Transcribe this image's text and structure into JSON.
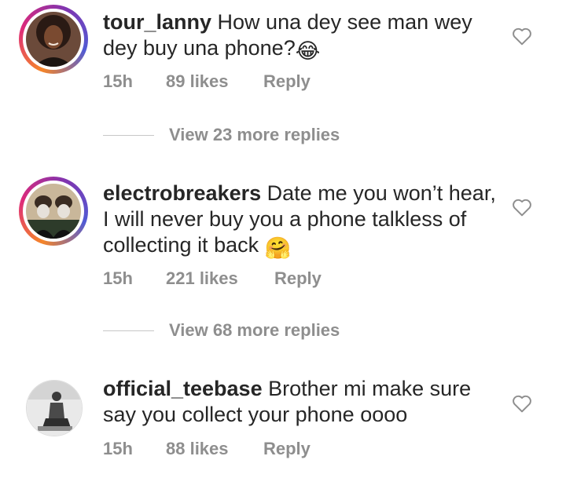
{
  "comments": [
    {
      "username": "tour_lanny",
      "text": "How una dey see man wey dey buy una phone?",
      "emoji": "😂",
      "time": "15h",
      "likes": "89 likes",
      "reply": "Reply",
      "view_more": "View 23 more replies",
      "avatar_story_ring": true
    },
    {
      "username": "electrobreakers",
      "text": "Date me you won’t hear, I will never buy you a phone talkless of collecting it back",
      "emoji": "🤗",
      "time": "15h",
      "likes": "221 likes",
      "reply": "Reply",
      "view_more": "View 68 more replies",
      "avatar_story_ring": true
    },
    {
      "username": "official_teebase",
      "text": "Brother mi make sure say you collect your phone oooo",
      "emoji": "",
      "time": "15h",
      "likes": "88 likes",
      "reply": "Reply",
      "avatar_story_ring": false
    }
  ],
  "icons": {
    "like": "heart-outline-icon"
  },
  "colors": {
    "text": "#262626",
    "meta": "#8e8e8e",
    "ring_start": "#f58529",
    "ring_end": "#dd2a7b"
  }
}
